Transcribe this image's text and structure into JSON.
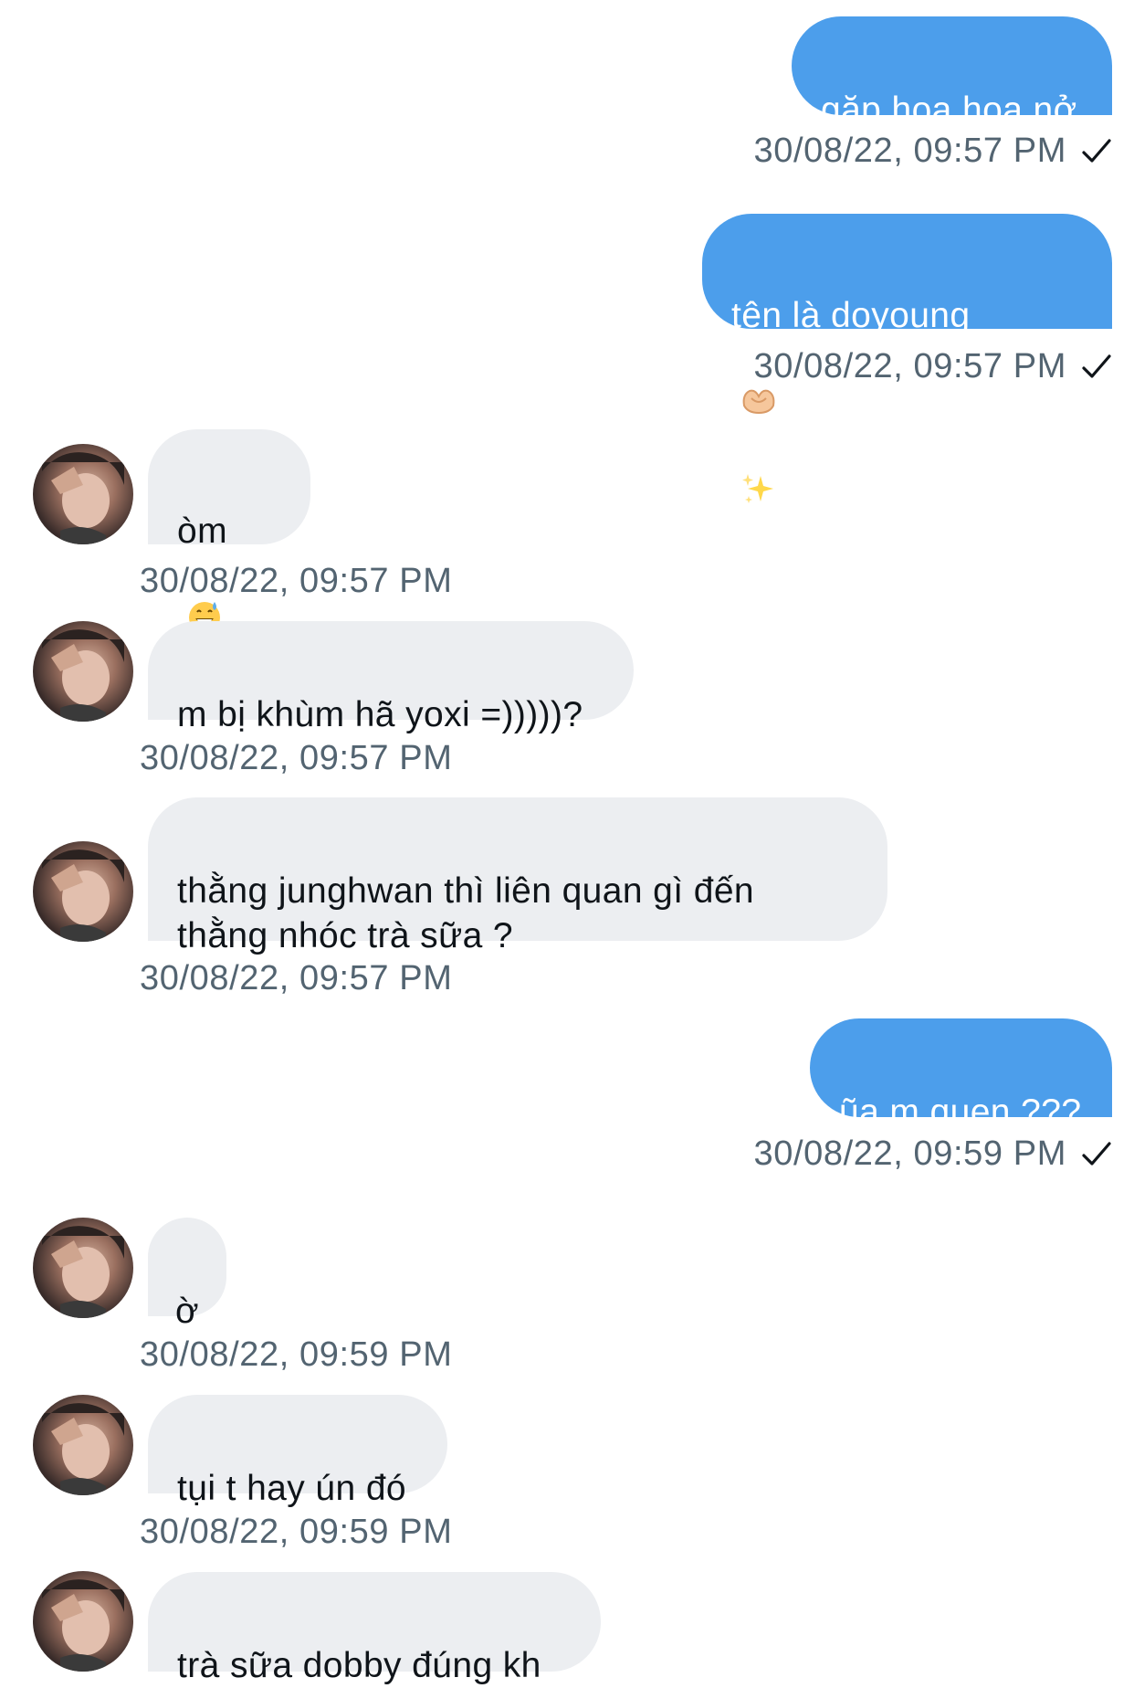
{
  "conversation": {
    "messages": [
      {
        "direction": "out",
        "text": "gặp hoa hoa nở",
        "timestamp": "30/08/22, 09:57 PM",
        "seen": "✓"
      },
      {
        "direction": "out",
        "text": "tên là doyoung",
        "emojis": [
          "heart-hands-icon",
          "sparkles-icon"
        ],
        "timestamp": "30/08/22, 09:57 PM",
        "seen": "✓"
      },
      {
        "direction": "in",
        "text": "òm",
        "emojis": [
          "grinning-sweat-icon"
        ],
        "timestamp": "30/08/22, 09:57 PM"
      },
      {
        "direction": "in",
        "text": "m bị khùm hã yoxi =)))))?",
        "timestamp": "30/08/22, 09:57 PM"
      },
      {
        "direction": "in",
        "text": "thằng junghwan thì liên quan gì đến\nthằng nhóc trà sữa ?",
        "timestamp": "30/08/22, 09:57 PM"
      },
      {
        "direction": "out",
        "text": "ũa m quen ???",
        "timestamp": "30/08/22, 09:59 PM",
        "seen": "✓"
      },
      {
        "direction": "in",
        "text": "ờ",
        "timestamp": "30/08/22, 09:59 PM"
      },
      {
        "direction": "in",
        "text": "tụi t hay ún đó",
        "timestamp": "30/08/22, 09:59 PM"
      },
      {
        "direction": "in",
        "text": "trà sữa dobby đúng kh",
        "timestamp": ""
      }
    ]
  },
  "colors": {
    "outgoing_bubble": "#4c9eeb",
    "incoming_bubble": "#eceef1",
    "timestamp": "#536471",
    "text": "#0f1419"
  }
}
